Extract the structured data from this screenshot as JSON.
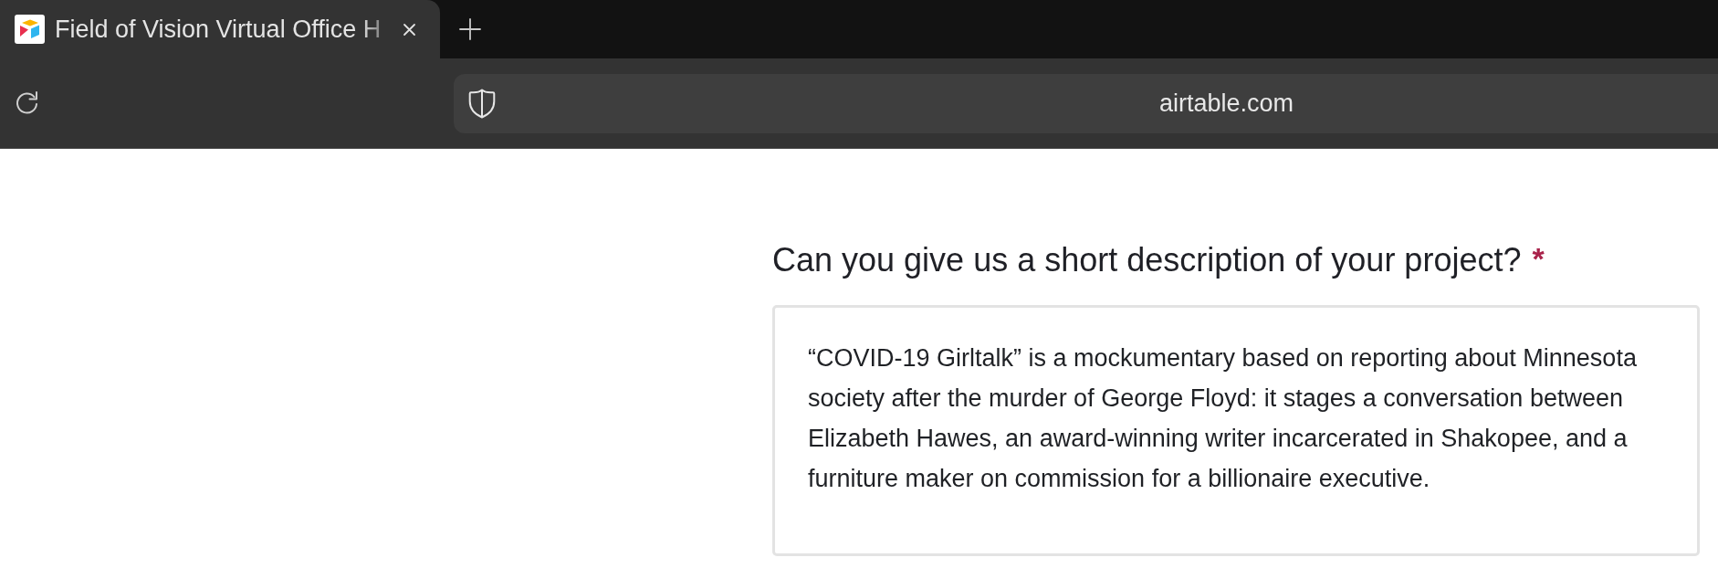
{
  "browser": {
    "tabs": [
      {
        "title": "Field of Vision Virtual Office H",
        "selected": true
      }
    ],
    "address": "airtable.com"
  },
  "form": {
    "question": "Can you give us a short description of your project?",
    "required_mark": "*",
    "answer": "“COVID-19 Girltalk” is a mockumentary based on reporting about Minnesota society after the murder of George Floyd: it stages a conversation between Elizabeth Hawes, an award-winning writer incarcerated in Shakopee, and a furniture maker on commission for a billionaire executive."
  }
}
